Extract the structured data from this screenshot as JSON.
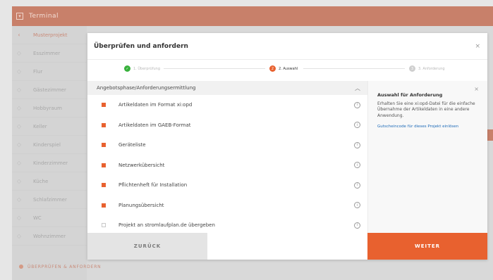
{
  "app": {
    "title": "Terminal",
    "sidebar_items": [
      "Musterprojekt",
      "Esszimmer",
      "Flur",
      "Gästezimmer",
      "Hobbyraum",
      "Keller",
      "Kinderspiel",
      "Kinderzimmer",
      "Küche",
      "Schlafzimmer",
      "WC",
      "Wohnzimmer"
    ],
    "sidebar_footer": "ÜBERPRÜFEN & ANFORDERN"
  },
  "modal": {
    "title": "Überprüfen und anfordern",
    "close_label": "×",
    "steps": [
      {
        "number": "✓",
        "label": "1. Überprüfung"
      },
      {
        "number": "2",
        "label": "2. Auswahl"
      },
      {
        "number": "3",
        "label": "3. Anforderung"
      }
    ],
    "section_title": "Angebotsphase/Anforderungsermittlung",
    "options": [
      {
        "label": "Artikeldaten im Format xi:opd",
        "checked": true
      },
      {
        "label": "Artikeldaten im GAEB-Format",
        "checked": true
      },
      {
        "label": "Geräteliste",
        "checked": true
      },
      {
        "label": "Netzwerkübersicht",
        "checked": true
      },
      {
        "label": "Pflichtenheft für Installation",
        "checked": true
      },
      {
        "label": "Planungsübersicht",
        "checked": true
      },
      {
        "label": "Projekt an stromlaufplan.de übergeben",
        "checked": false
      }
    ],
    "info": {
      "title": "Auswahl für Anforderung",
      "text": "Erhalten Sie eine xi:opd-Datei für die einfache Übernahme der Artikeldaten in eine andere Anwendung.",
      "link": "Gutscheincode für dieses Projekt einlösen"
    },
    "back_label": "ZURÜCK",
    "next_label": "WEITER"
  },
  "colors": {
    "accent": "#e8612f",
    "success": "#38b13c",
    "link": "#1e6bb8"
  }
}
